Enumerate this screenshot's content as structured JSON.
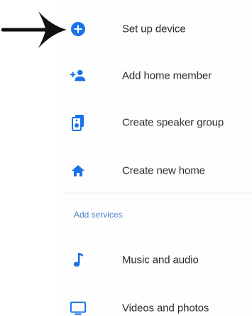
{
  "menu": {
    "items": [
      {
        "label": "Set up device",
        "icon": "add-circle-icon"
      },
      {
        "label": "Add home member",
        "icon": "add-person-icon"
      },
      {
        "label": "Create speaker group",
        "icon": "speaker-group-icon"
      },
      {
        "label": "Create new home",
        "icon": "home-icon"
      }
    ]
  },
  "services": {
    "header": "Add services",
    "items": [
      {
        "label": "Music and audio",
        "icon": "music-note-icon"
      },
      {
        "label": "Videos and photos",
        "icon": "tv-icon"
      }
    ]
  },
  "colors": {
    "accent": "#1a73e8",
    "text": "#2b2b2b",
    "section": "#4a7fc8"
  }
}
